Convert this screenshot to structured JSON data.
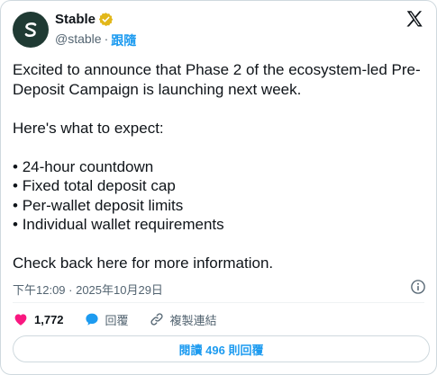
{
  "account": {
    "name": "Stable",
    "handle": "@stable",
    "separator": "·",
    "follow_label": "跟隨",
    "avatar_letter": "S"
  },
  "tweet": {
    "lines": [
      "Excited to announce that Phase 2 of the ecosystem-led Pre-Deposit Campaign is launching next week.",
      "Here's what to expect:"
    ],
    "bullets": [
      "24-hour countdown",
      "Fixed total deposit cap",
      "Per-wallet deposit limits",
      "Individual wallet requirements"
    ],
    "closing": "Check back here for more information."
  },
  "meta": {
    "timestamp": "下午12:09 · 2025年10月29日"
  },
  "actions": {
    "like_count": "1,772",
    "reply_label": "回覆",
    "copy_link_label": "複製連結"
  },
  "replies_button": {
    "label": "閱讀 496 則回覆"
  },
  "colors": {
    "accent": "#1d9bf0",
    "like": "#f91880",
    "verified": "#e2b719",
    "avatar_bg": "#1f3a33"
  },
  "icons": [
    "s-logo-icon",
    "verified-badge-icon",
    "x-logo-icon",
    "info-icon",
    "heart-icon",
    "reply-bubble-icon",
    "link-icon"
  ]
}
